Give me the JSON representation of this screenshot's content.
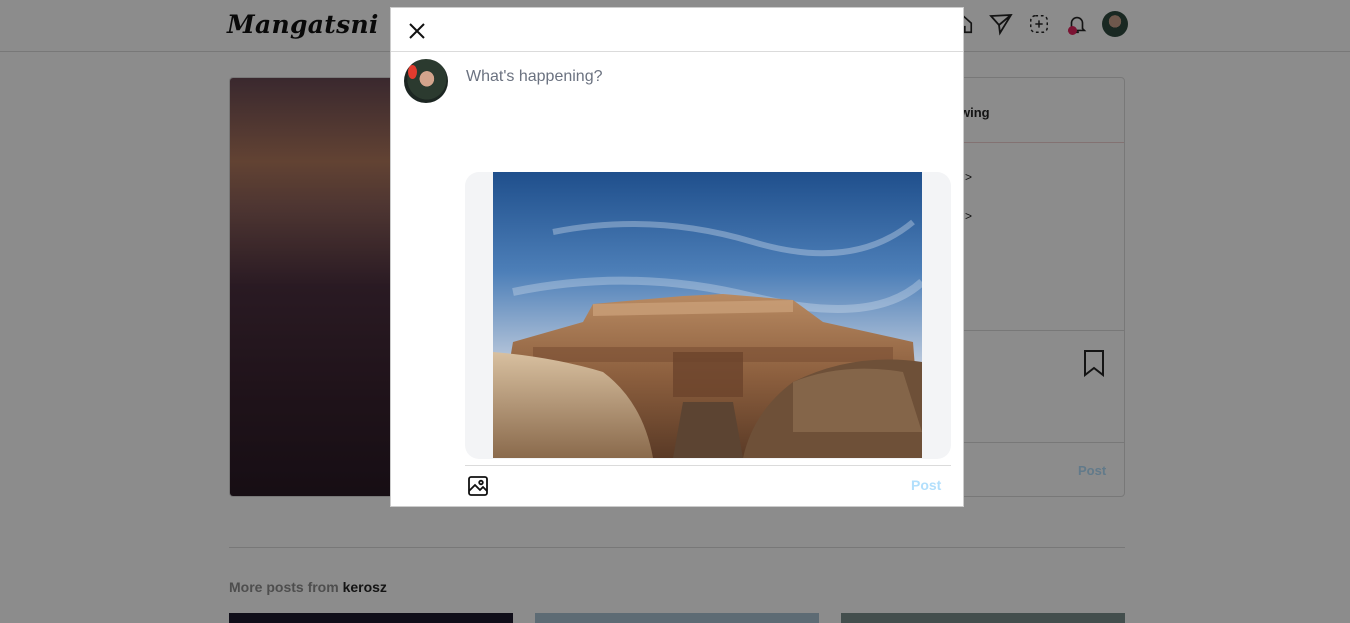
{
  "app": {
    "logo": "Mangatsni"
  },
  "nav": {
    "icons": [
      "home-icon",
      "send-icon",
      "new-post-icon",
      "notifications-icon",
      "avatar"
    ]
  },
  "background_post": {
    "follow_label": "wing",
    "comment_arrows": [
      ">",
      ">"
    ],
    "post_button": "Post"
  },
  "more_posts": {
    "prefix": "More posts from",
    "username": "kerosz"
  },
  "modal": {
    "close_icon": "close-icon",
    "composer_placeholder": "What's happening?",
    "composer_value": "",
    "attach_icon": "image-icon",
    "post_button": "Post"
  },
  "colors": {
    "post_button_disabled": "#b2dffc",
    "notification_dot": "#e0245e",
    "overlay": "rgba(0,0,0,0.45)"
  }
}
